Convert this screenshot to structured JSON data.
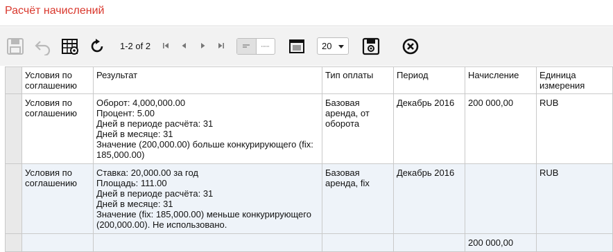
{
  "page": {
    "title": "Расчёт начислений"
  },
  "toolbar": {
    "pager_text": "1-2 of 2",
    "page_size": "20",
    "icons": [
      "save-icon",
      "undo-icon",
      "grid-settings-icon",
      "refresh-icon",
      "first-page-icon",
      "prev-page-icon",
      "next-page-icon",
      "last-page-icon",
      "align-left-icon",
      "align-justify-icon",
      "window-icon",
      "export-icon",
      "close-icon"
    ]
  },
  "table": {
    "headers": {
      "conditions": "Условия по соглашению",
      "result": "Результат",
      "payment_type": "Тип оплаты",
      "period": "Период",
      "accrual": "Начисление",
      "unit": "Единица измерения"
    },
    "rows": [
      {
        "conditions": "Условия по соглашению",
        "result": [
          "Оборот: 4,000,000.00",
          "Процент: 5.00",
          "Дней в периоде расчёта: 31",
          "Дней в месяце: 31",
          "Значение (200,000.00) больше конкурирующего (fix: 185,000.00)"
        ],
        "payment_type": "Базовая аренда, от оборота",
        "period": "Декабрь 2016",
        "accrual": "200 000,00",
        "unit": "RUB"
      },
      {
        "conditions": "Условия по соглашению",
        "result": [
          "Ставка: 20,000.00 за год",
          "Площадь: 111.00",
          "Дней в периоде расчёта: 31",
          "Дней в месяце: 31",
          "Значение (fix: 185,000.00) меньше конкурирующего (200,000.00). Не использовано."
        ],
        "payment_type": "Базовая аренда, fix",
        "period": "Декабрь 2016",
        "accrual": "",
        "unit": "RUB"
      }
    ],
    "total": {
      "accrual": "200 000,00"
    }
  },
  "colors": {
    "title": "#d9372c",
    "link": "#1f5fb4",
    "row_alt": "#eef3f9",
    "toolbar_bg": "#f2f2f2"
  }
}
